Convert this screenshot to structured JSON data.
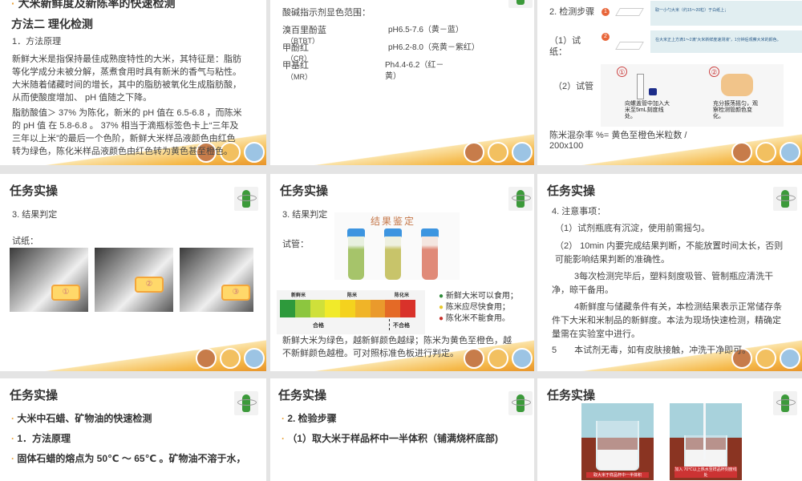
{
  "slides": [
    {
      "heading": "大米新鲜度及新陈率的快速检测",
      "method": "方法二 理化检测",
      "sub": "1．方法原理",
      "p1": "新鲜大米是指保持最佳成熟度特性的大米，其特征是：脂肪等化学成分未被分解，蒸煮食用时具有新米的香气与粘性。大米随着储藏时间的增长，其中的脂肪被氧化生成脂肪酸，从而使酸度增加、 pH 值随之下降。",
      "p2": "脂肪酸值＞ 37% 为陈化，新米的 pH 值在 6.5-6.8 ，而陈米的 pH 值 在 5.8-6.8 。 37% 相当于滴瓶标签色卡上“三年及三年以上米”的最后一个色阶，新鲜大米样品液颜色由红色转为绿色，陈化米样品液颜色由红色转为黄色甚至橙色。"
    },
    {
      "heading": "酸碱指示剂显色范围：",
      "rows": [
        {
          "name": "溴百里酚蓝",
          "abbr": "（BTBT）",
          "range": "pH6.5-7.6（黄－蓝）"
        },
        {
          "name": "甲酚红",
          "abbr": "（CR）",
          "range": "pH6.2-8.0（亮黄－紫红）"
        },
        {
          "name": "甲基红",
          "abbr": "（MR）",
          "range": "Ph4.4-6.2（红－黄）"
        }
      ]
    },
    {
      "step": "2. 检测步骤",
      "paper": "（1）试纸：",
      "tube": "（2）试管",
      "n1": "1",
      "n2": "2",
      "box1": "取一小勺大米（约15～20粒）于白纸上；",
      "box2": "在大米正上方滴1～2滴“大米新鲜度速测液”，1分钟后观察大米的颜色。",
      "c1": "①",
      "c2": "②",
      "cap1": "向螺盖管中加入大米至5mL刻度线处。",
      "cap2": "充分振荡摇匀，观察检测管颜色变化。",
      "formula": "陈米混杂率 %= 黄色至橙色米粒数 / 200x100"
    },
    {
      "title": "任务实操",
      "sub": "3. 结果判定",
      "paper": "试纸：",
      "tags": [
        "①",
        "②",
        "③"
      ]
    },
    {
      "title": "任务实操",
      "sub": "3. 结果判定",
      "tube": "试管：",
      "img_title": "结果鉴定",
      "scale": {
        "fresh": "新鲜米",
        "old": "陈米",
        "aged": "陈化米",
        "pass": "合格",
        "fail": "不合格",
        "colors": [
          "#2e9a3c",
          "#8cc63f",
          "#cfe03a",
          "#f1ea2a",
          "#f4d21e",
          "#f0b428",
          "#ea9a2c",
          "#e46a26",
          "#d9322a"
        ]
      },
      "legend": [
        {
          "text": "新鲜大米可以食用；",
          "color": "#2e8b3a"
        },
        {
          "text": "陈米应尽快食用；",
          "color": "#e8c82a"
        },
        {
          "text": "陈化米不能食用。",
          "color": "#c8302a"
        }
      ],
      "p": "新鲜大米为绿色，越新鲜颜色越绿；陈米为黄色至橙色，越不新鲜颜色越橙。可对照标准色板进行判定。"
    },
    {
      "title": "任务实操",
      "lines": [
        "4. 注意事项：",
        "（1）试剂瓶底有沉淀，使用前需摇匀。",
        "（2） 10min 内要完成结果判断，不能放置时间太长，否则可能影响结果判断的准确性。",
        "3每次检测完毕后，塑料刻度吸管、管制瓶应清洗干净，晾干备用。",
        "4新鲜度与储藏条件有关，本检测结果表示正常储存条件下大米和米制品的新鲜度。本法为现场快速检测，精确定量需在实验室中进行。",
        "5　　本试剂无毒，如有皮肤接触，冲洗干净即可。"
      ]
    },
    {
      "title": "任务实操",
      "lines": [
        "大米中石蜡、矿物油的快速检测",
        "1．方法原理",
        "固体石蜡的熔点为 50℃ ～ 65℃ 。矿物油不溶于水，"
      ]
    },
    {
      "title": "任务实操",
      "lines": [
        "2. 检验步骤",
        "（1）取大米于样品杯中一半体积（铺满烧杯底部)"
      ]
    },
    {
      "title": "任务实操",
      "cap1": "取大米于样品杯中一半体积",
      "cap2": "加入 70℃以上热水至样品杯刻度线处"
    }
  ]
}
